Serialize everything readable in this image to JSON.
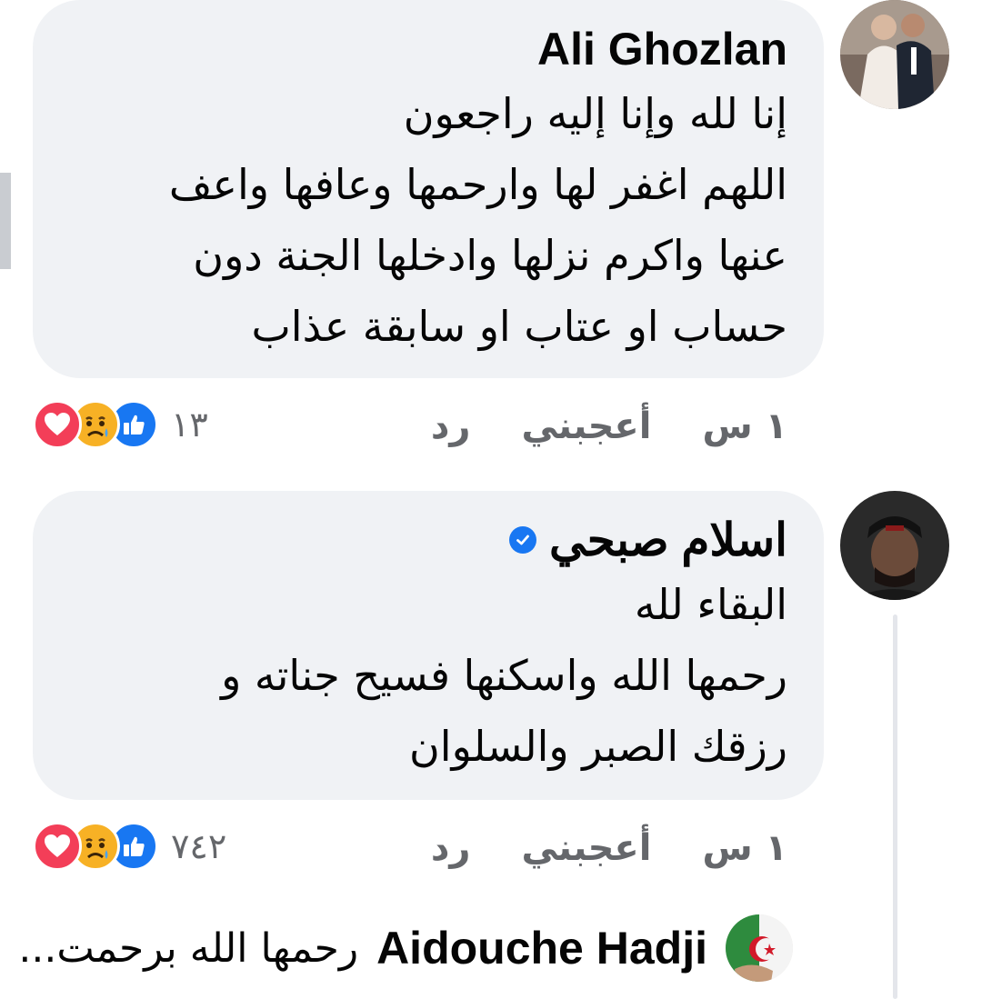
{
  "comments": [
    {
      "author": "Ali Ghozlan",
      "verified": false,
      "text": "إنا لله وإنا إليه راجعون\n اللهم اغفر لها وارحمها وعافها واعف\nعنها واكرم نزلها وادخلها الجنة دون\nحساب او عتاب او سابقة عذاب",
      "time": "١ س",
      "like_label": "أعجبني",
      "reply_label": "رد",
      "reaction_count": "١٣",
      "reactions": [
        "like-icon",
        "sad-icon",
        "love-icon"
      ]
    },
    {
      "author": "اسلام صبحي",
      "verified": true,
      "text": "البقاء لله\nرحمها الله واسكنها فسيح جناته و\nرزقك الصبر والسلوان",
      "time": "١ س",
      "like_label": "أعجبني",
      "reply_label": "رد",
      "reaction_count": "٧٤٢",
      "reactions": [
        "like-icon",
        "sad-icon",
        "love-icon"
      ]
    }
  ],
  "reply": {
    "author": "Aidouche Hadji",
    "text": "رحمها الله برحمت..."
  },
  "colors": {
    "bubble": "#f0f2f5",
    "meta_text": "#65676b",
    "like_blue": "#1877f2",
    "love_red": "#f33e58",
    "sad_yellow": "#f7b125"
  }
}
